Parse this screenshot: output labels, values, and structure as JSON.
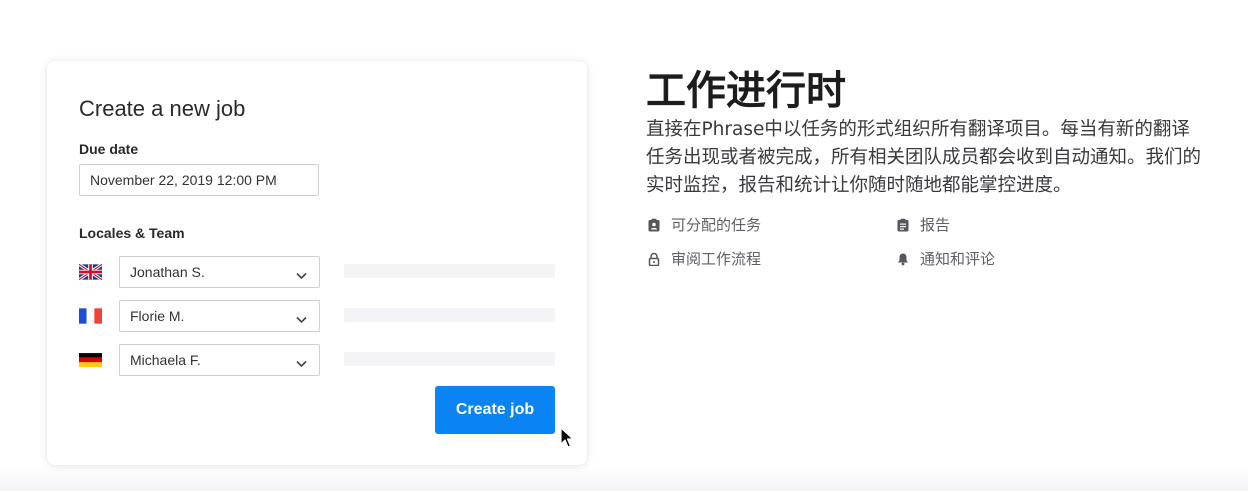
{
  "form": {
    "title": "Create a new job",
    "due_date_label": "Due date",
    "due_date_value": "November 22, 2019 12:00 PM",
    "locales_label": "Locales & Team",
    "rows": [
      {
        "flag": "uk-flag-icon",
        "assignee": "Jonathan S."
      },
      {
        "flag": "france-flag-icon",
        "assignee": "Florie M."
      },
      {
        "flag": "germany-flag-icon",
        "assignee": "Michaela F."
      }
    ],
    "create_label": "Create job"
  },
  "promo": {
    "heading": "工作进行时",
    "description": "直接在Phrase中以任务的形式组织所有翻译项目。每当有新的翻译任务出现或者被完成，所有相关团队成员都会收到自动通知。我们的实时监控，报告和统计让你随时随地都能掌控进度。",
    "features": [
      {
        "icon": "assignment-icon",
        "label": "可分配的任务"
      },
      {
        "icon": "report-icon",
        "label": "报告"
      },
      {
        "icon": "lock-icon",
        "label": "审阅工作流程"
      },
      {
        "icon": "bell-icon",
        "label": "通知和评论"
      }
    ]
  },
  "colors": {
    "button": "#0a84f2",
    "placeholder_bar": "#f4f4f7"
  }
}
